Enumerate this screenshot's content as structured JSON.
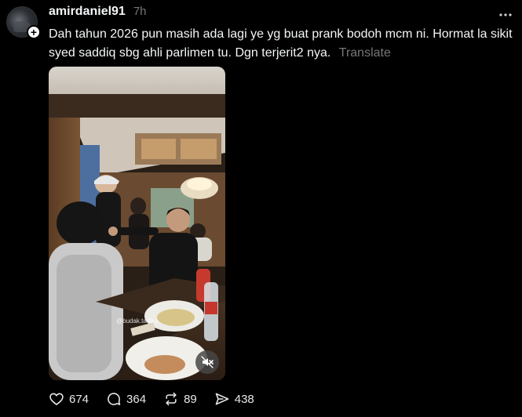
{
  "post": {
    "username": "amirdaniel91",
    "time": "7h",
    "caption": "Dah tahun 2026 pun masih ada lagi ye yg buat prank bodoh mcm ni. Hormat la sikit syed saddiq sbg ahli parlimen tu. Dgn terjerit2 nya.",
    "translate_label": "Translate",
    "media_watermark": "@budak.tadika"
  },
  "icons": {
    "avatar": "profile-photo",
    "follow": "plus-icon",
    "more": "more-horizontal-icon",
    "mute": "speaker-muted-icon",
    "like": "heart-icon",
    "reply": "comment-bubble-icon",
    "repost": "repost-arrows-icon",
    "share": "send-icon"
  },
  "actions": {
    "likes": "674",
    "replies": "364",
    "reposts": "89",
    "shares": "438"
  },
  "colors": {
    "background": "#000000",
    "text": "#f3f5f7",
    "muted": "#777777"
  }
}
